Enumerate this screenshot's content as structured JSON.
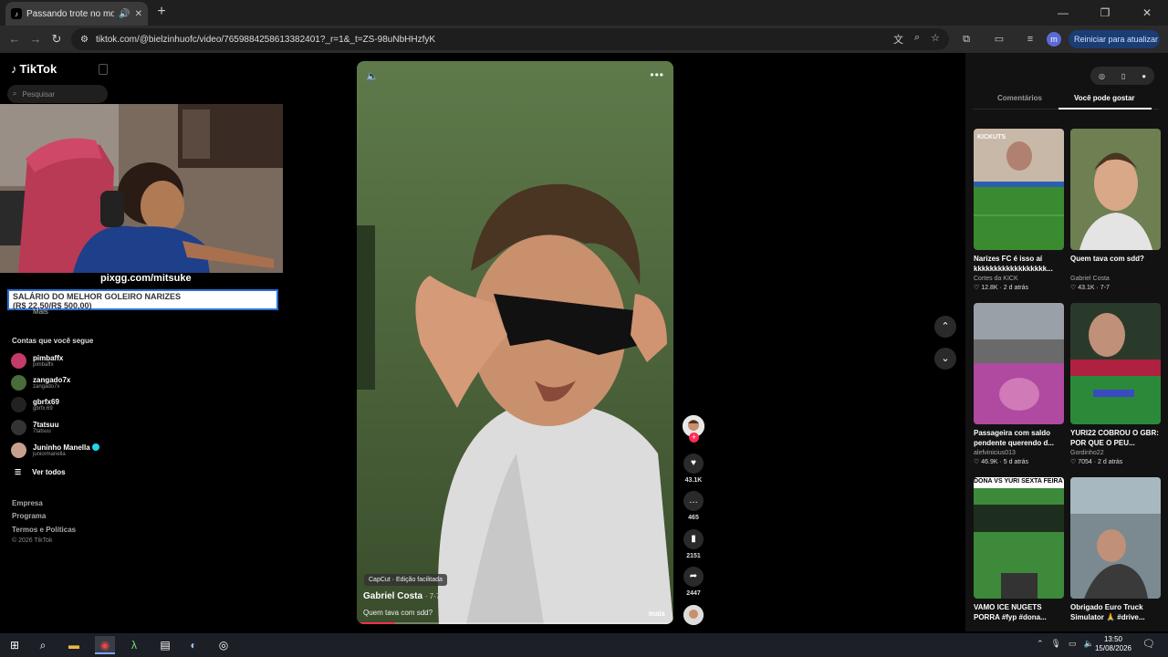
{
  "browser": {
    "tab_title": "Passando trote no motel: G",
    "url": "tiktok.com/@bielzinhuofc/video/7659884258613382401?_r=1&_t=ZS-98uNbHHzfyK",
    "update_button": "Reiniciar para atualizar",
    "profile_initial": "m"
  },
  "sidebar": {
    "logo": "TikTok",
    "search_placeholder": "Pesquisar",
    "overlay_url": "pixgg.com/mitsuke",
    "overlay_salary_line1": "SALÁRIO DO MELHOR GOLEIRO NARIZES",
    "overlay_salary_line2": "(R$ 22,50/R$ 500,00)",
    "more_label": "Mais",
    "following_title": "Contas que você segue",
    "accounts": [
      {
        "name": "pimbaffx",
        "handle": "pimbaffx",
        "color": "#c23b6a"
      },
      {
        "name": "zangado7x",
        "handle": "zangado7x",
        "color": "#4a6b3a"
      },
      {
        "name": "gbrfx69",
        "handle": "gbrfx.69",
        "color": "#222222"
      },
      {
        "name": "7tatsuu",
        "handle": "7tatsuu",
        "color": "#333333"
      },
      {
        "name": "Juninho Manella",
        "handle": "juniormanella",
        "color": "#c8a090"
      }
    ],
    "see_all": "Ver todos",
    "footer": [
      "Empresa",
      "Programa",
      "Termos e Políticas"
    ],
    "copyright": "© 2026 TikTok"
  },
  "video": {
    "capcut_badge": "CapCut · Edição facilitada",
    "author": "Gabriel Costa",
    "date": "· 7-7",
    "caption": "Quem tava com sdd?",
    "more": "mais",
    "progress": 0.12,
    "likes": "43.1K",
    "comments": "465",
    "saves": "2151",
    "shares": "2447"
  },
  "right": {
    "tab_comments": "Comentários",
    "tab_suggested": "Você pode gostar",
    "cards": [
      {
        "title": "Narizes FC é isso aí kkkkkkkkkkkkkkkkkk...",
        "author": "Cortes da KICK",
        "likes": "12.8K",
        "age": "2 d atrás",
        "c1": "#3a7d2f",
        "c2": "#2a5fb0",
        "label": "KICKUTS"
      },
      {
        "title": "Quem tava com sdd?",
        "author": "Gabriel Costa",
        "likes": "43.1K",
        "age": "7-7",
        "c1": "#7a8b5a",
        "c2": "#d8c0a8",
        "label": ""
      },
      {
        "title": "Passageira com saldo pendente querendo d...",
        "author": "alefvinicius013",
        "likes": "46.9K",
        "age": "5 d atrás",
        "c1": "#8a8f96",
        "c2": "#b040a0",
        "label": ""
      },
      {
        "title": "YURI22 COBROU O GBR: POR QUE O PEU...",
        "author": "Gordinho22",
        "likes": "7054",
        "age": "2 d atrás",
        "c1": "#2a6e3a",
        "c2": "#3a4ac0",
        "label": ""
      },
      {
        "title": "VAMO ICE NUGETS PORRA #fyp #dona...",
        "author": "",
        "likes": "",
        "age": "",
        "c1": "#3d8a3a",
        "c2": "#1e3e1e",
        "label": "DONA VS YURI SEXTA FEIRA"
      },
      {
        "title": "Obrigado Euro Truck Simulator 🙏 #drive...",
        "author": "",
        "likes": "",
        "age": "",
        "c1": "#7a8a90",
        "c2": "#c0a080",
        "label": ""
      }
    ]
  },
  "taskbar": {
    "time": "13:50",
    "date": "15/08/2026"
  }
}
